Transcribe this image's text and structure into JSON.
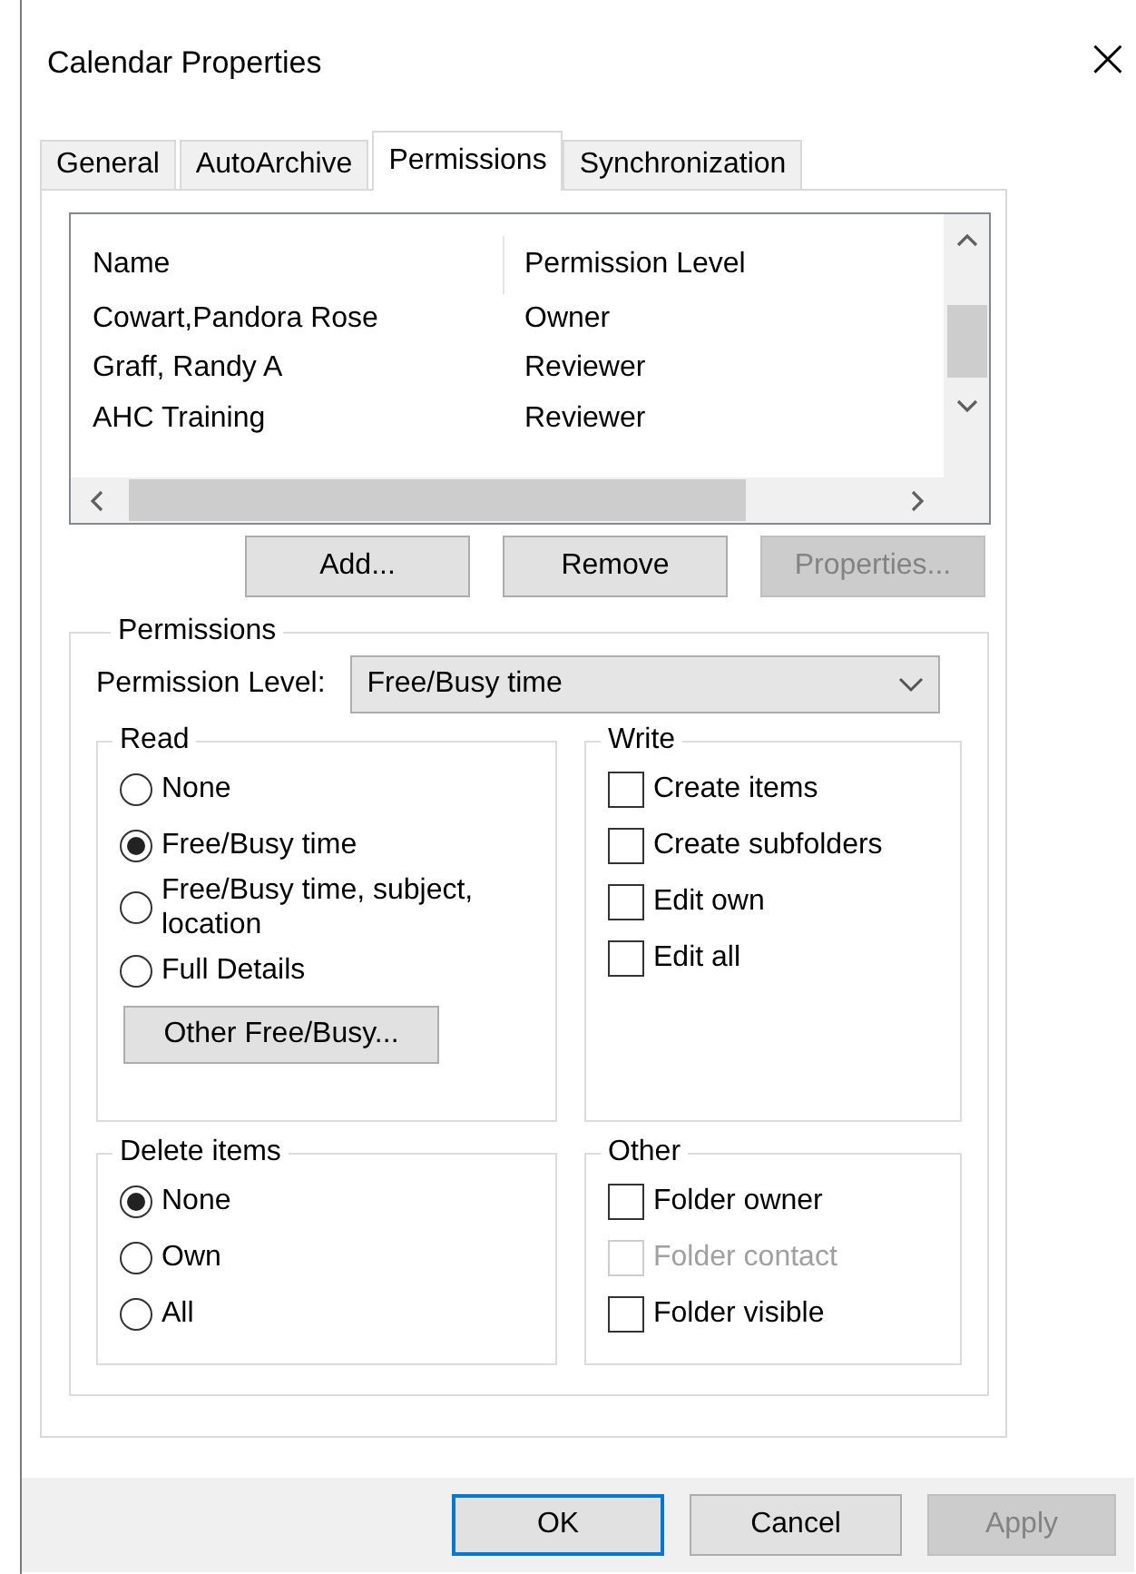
{
  "window": {
    "title": "Calendar Properties",
    "close": "×"
  },
  "tabs": [
    {
      "label": "General",
      "selected": false
    },
    {
      "label": "AutoArchive",
      "selected": false
    },
    {
      "label": "Permissions",
      "selected": true
    },
    {
      "label": "Synchronization",
      "selected": false
    }
  ],
  "permissions_list": {
    "columns": [
      "Name",
      "Permission Level"
    ],
    "rows": [
      {
        "name": "Cowart,Pandora Rose",
        "permission_level": "Owner"
      },
      {
        "name": "Graff, Randy A",
        "permission_level": "Reviewer"
      },
      {
        "name": "AHC Training",
        "permission_level": "Reviewer"
      }
    ]
  },
  "list_buttons": [
    {
      "label": "Add...",
      "disabled": false
    },
    {
      "label": "Remove",
      "disabled": false
    },
    {
      "label": "Properties...",
      "disabled": true
    }
  ],
  "permissions_group": {
    "title": "Permissions",
    "permission_level_label": "Permission Level:",
    "permission_level_value": "Free/Busy time",
    "read": {
      "title": "Read",
      "options": [
        {
          "label": "None",
          "selected": false
        },
        {
          "label": "Free/Busy time",
          "selected": true
        },
        {
          "label": "Free/Busy time, subject, location",
          "selected": false
        },
        {
          "label": "Full Details",
          "selected": false
        }
      ],
      "button": "Other Free/Busy..."
    },
    "write": {
      "title": "Write",
      "items": [
        {
          "label": "Create items",
          "checked": false,
          "disabled": false
        },
        {
          "label": "Create subfolders",
          "checked": false,
          "disabled": false
        },
        {
          "label": "Edit own",
          "checked": false,
          "disabled": false
        },
        {
          "label": "Edit all",
          "checked": false,
          "disabled": false
        }
      ]
    },
    "delete_items": {
      "title": "Delete items",
      "options": [
        {
          "label": "None",
          "selected": true
        },
        {
          "label": "Own",
          "selected": false
        },
        {
          "label": "All",
          "selected": false
        }
      ]
    },
    "other": {
      "title": "Other",
      "items": [
        {
          "label": "Folder owner",
          "checked": false,
          "disabled": false
        },
        {
          "label": "Folder contact",
          "checked": false,
          "disabled": true
        },
        {
          "label": "Folder visible",
          "checked": false,
          "disabled": false
        }
      ]
    }
  },
  "footer_buttons": [
    {
      "label": "OK",
      "default": true,
      "disabled": false
    },
    {
      "label": "Cancel",
      "default": false,
      "disabled": false
    },
    {
      "label": "Apply",
      "default": false,
      "disabled": true
    }
  ]
}
